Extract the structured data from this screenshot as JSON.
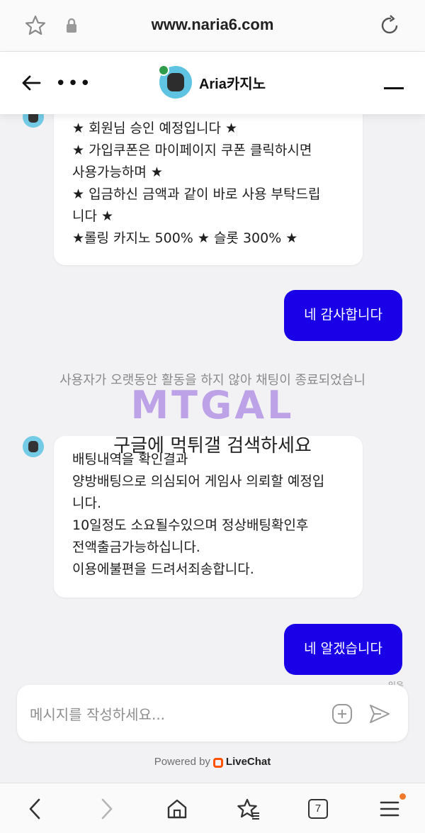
{
  "browser": {
    "url": "www.naria6.com"
  },
  "header": {
    "agent_name": "Aria카지노"
  },
  "messages": {
    "agent_1": [
      "★ 회원님 승인 예정입니다 ★",
      "★ 가입쿠폰은 마이페이지 쿠폰 클릭하시면",
      "사용가능하며 ★",
      "★ 입금하신 금액과 같이 바로 사용 부탁드립",
      "니다 ★",
      "★롤링 카지노 500% ★ 슬롯 300% ★"
    ],
    "user_1": "네 감사합니다",
    "system": "사용자가 오랫동안 활동을 하지 않아 채팅이 종료되었습니",
    "agent_2": [
      "배팅내역을 확인결과",
      "양방배팅으로 의심되어 게임사 의뢰할 예정입",
      "니다.",
      "10일정도 소요될수있으며 정상배팅확인후",
      "전액출금가능하십니다.",
      "이용에불편을 드려서죄송합니다."
    ],
    "user_2": "네 알겠습니다",
    "read_tag": "읽음"
  },
  "watermark": {
    "logo": "MTGAL",
    "text": "구글에 먹튀갤 검색하세요"
  },
  "composer": {
    "placeholder": "메시지를 작성하세요..."
  },
  "footer": {
    "powered_prefix": "Powered by",
    "powered_brand": "LiveChat"
  },
  "bottom_nav": {
    "tab_count": "7"
  },
  "colors": {
    "user_bubble": "#1a00e6",
    "livechat_orange": "#ff5100",
    "notification": "#f07a2a"
  }
}
